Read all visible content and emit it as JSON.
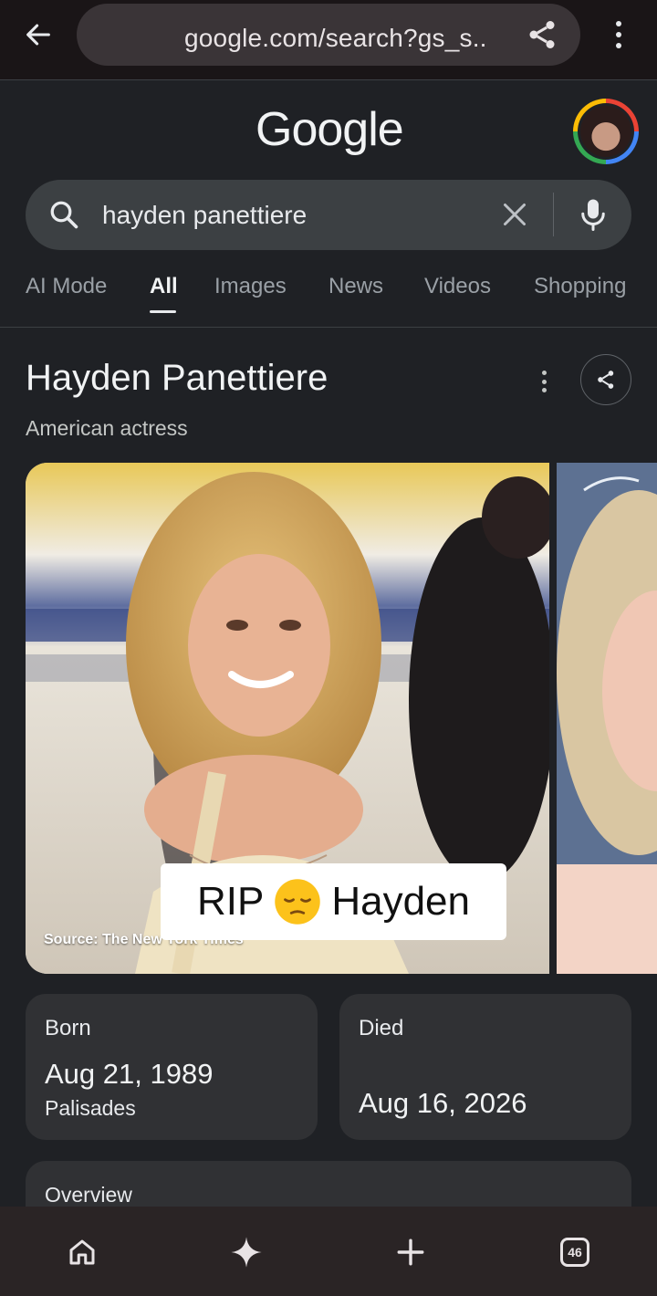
{
  "browser": {
    "url": "google.com/search?gs_s..",
    "tab_count": "46"
  },
  "header": {
    "logo": "Google"
  },
  "search": {
    "query": "hayden panettiere"
  },
  "tabs": [
    {
      "label": "AI Mode"
    },
    {
      "label": "All"
    },
    {
      "label": "Images"
    },
    {
      "label": "News"
    },
    {
      "label": "Videos"
    },
    {
      "label": "Shopping"
    }
  ],
  "knowledge_panel": {
    "title": "Hayden Panettiere",
    "subtitle": "American actress",
    "image_source": "Source: The New York Times",
    "caption": {
      "before": "RIP",
      "after": "Hayden"
    },
    "born": {
      "label": "Born",
      "date": "Aug 21, 1989",
      "place": "Palisades"
    },
    "died": {
      "label": "Died",
      "date": "Aug 16, 2026"
    },
    "overview_label": "Overview"
  },
  "colors": {
    "background": "#1f2125",
    "card": "#303134",
    "searchbar": "#3c4043"
  }
}
